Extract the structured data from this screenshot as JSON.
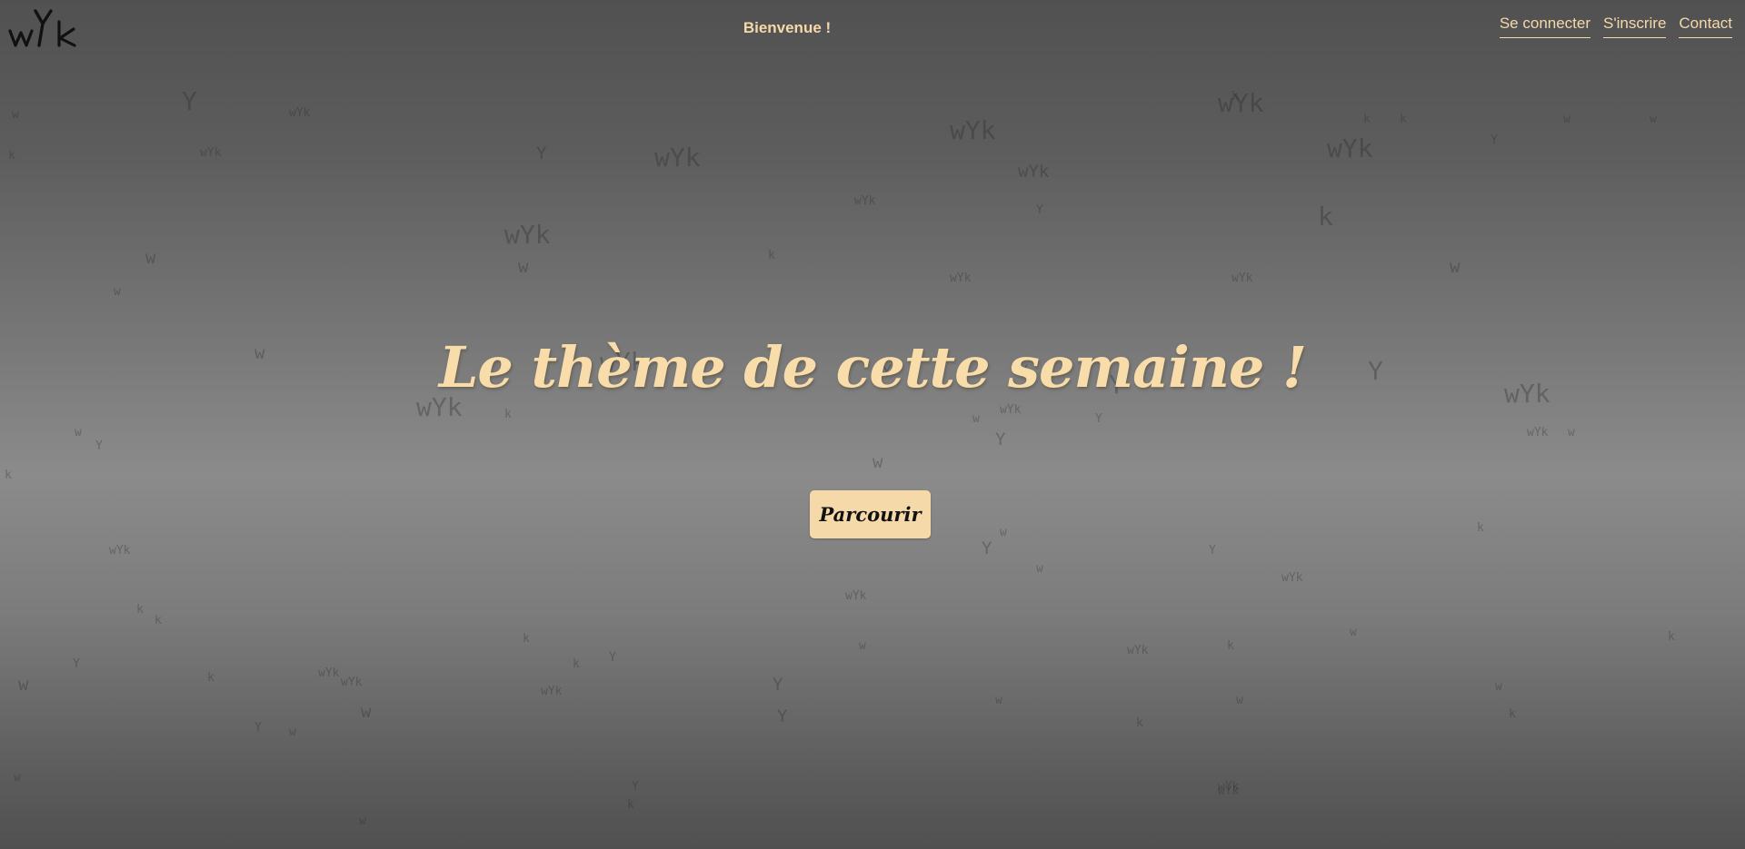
{
  "header": {
    "logo_text": "wYk",
    "welcome": "Bienvenue !",
    "nav": [
      {
        "label": "Se connecter"
      },
      {
        "label": "S'inscrire"
      },
      {
        "label": "Contact"
      }
    ]
  },
  "hero": {
    "title": "Le thème de cette semaine !",
    "button_label": "Parcourir"
  },
  "background_letters": [
    "w",
    "Y",
    "k",
    "wYk"
  ],
  "colors": {
    "accent": "#f5d9a9",
    "background_dark": "#515151",
    "background_light": "#8b8b8b",
    "logo": "#111111"
  }
}
